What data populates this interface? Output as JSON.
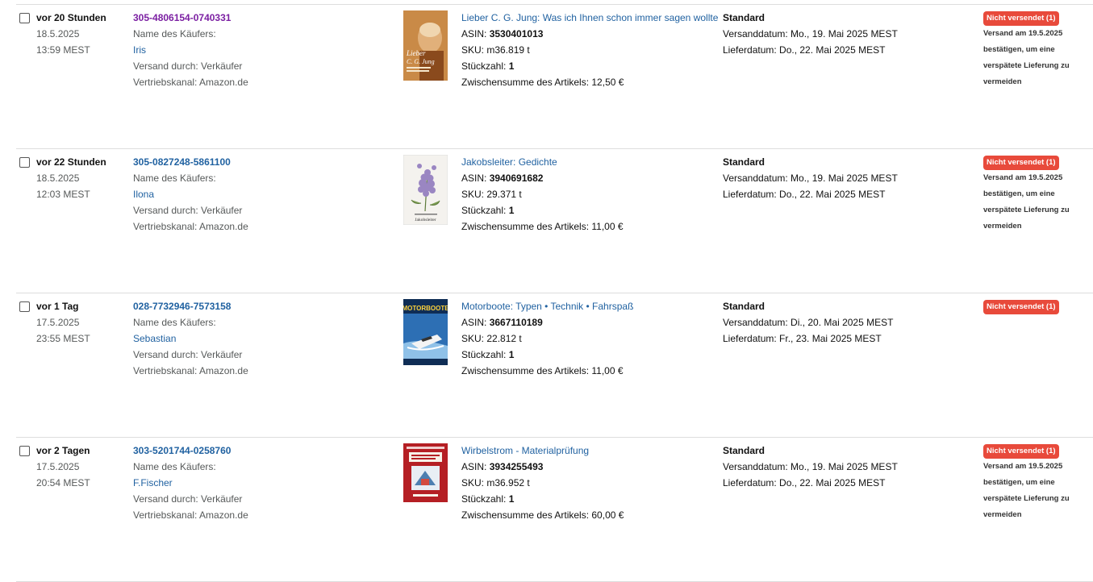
{
  "orders": [
    {
      "age": "vor 20 Stunden",
      "date": "18.5.2025",
      "time": "13:59 MEST",
      "order_id": "305-4806154-0740331",
      "buyer_label": "Name des Käufers:",
      "buyer_name": "Iris",
      "fulfilled_by": "Versand durch: Verkäufer",
      "sales_channel": "Vertriebskanal: Amazon.de",
      "product_title": "Lieber C. G. Jung: Was ich Ihnen schon immer sagen wollte",
      "asin_label": "ASIN:",
      "asin": "3530401013",
      "sku": "SKU: m36.819 t",
      "qty_label": "Stückzahl:",
      "qty": "1",
      "subtotal": "Zwischensumme des Artikels: 12,50 €",
      "shipping_service": "Standard",
      "ship_date": "Versanddatum: Mo., 19. Mai 2025 MEST",
      "delivery_date": "Lieferdatum: Do., 22. Mai 2025 MEST",
      "status_badge": "Nicht versendet (1)",
      "status_note": [
        "Versand am 19.5.2025",
        "bestätigen, um eine",
        "verspätete Lieferung zu",
        "vermeiden"
      ],
      "cover_icon": "book-cover-lieber-cg-jung",
      "cover_text": [
        "Lieber",
        "C. G. Jung"
      ]
    },
    {
      "age": "vor 22 Stunden",
      "date": "18.5.2025",
      "time": "12:03 MEST",
      "order_id": "305-0827248-5861100",
      "buyer_label": "Name des Käufers:",
      "buyer_name": "Ilona",
      "fulfilled_by": "Versand durch: Verkäufer",
      "sales_channel": "Vertriebskanal: Amazon.de",
      "product_title": "Jakobsleiter: Gedichte",
      "asin_label": "ASIN:",
      "asin": "3940691682",
      "sku": "SKU: 29.371 t",
      "qty_label": "Stückzahl:",
      "qty": "1",
      "subtotal": "Zwischensumme des Artikels: 11,00 €",
      "shipping_service": "Standard",
      "ship_date": "Versanddatum: Mo., 19. Mai 2025 MEST",
      "delivery_date": "Lieferdatum: Do., 22. Mai 2025 MEST",
      "status_badge": "Nicht versendet (1)",
      "status_note": [
        "Versand am 19.5.2025",
        "bestätigen, um eine",
        "verspätete Lieferung zu",
        "vermeiden"
      ],
      "cover_icon": "book-cover-jakobsleiter",
      "cover_text": [
        "Jakobsleiter"
      ]
    },
    {
      "age": "vor 1 Tag",
      "date": "17.5.2025",
      "time": "23:55 MEST",
      "order_id": "028-7732946-7573158",
      "buyer_label": "Name des Käufers:",
      "buyer_name": "Sebastian",
      "fulfilled_by": "Versand durch: Verkäufer",
      "sales_channel": "Vertriebskanal: Amazon.de",
      "product_title": "Motorboote: Typen • Technik • Fahrspaß",
      "asin_label": "ASIN:",
      "asin": "3667110189",
      "sku": "SKU: 22.812 t",
      "qty_label": "Stückzahl:",
      "qty": "1",
      "subtotal": "Zwischensumme des Artikels: 11,00 €",
      "shipping_service": "Standard",
      "ship_date": "Versanddatum: Di., 20. Mai 2025 MEST",
      "delivery_date": "Lieferdatum: Fr., 23. Mai 2025 MEST",
      "status_badge": "Nicht versendet (1)",
      "status_note": [],
      "cover_icon": "book-cover-motorboote",
      "cover_text": [
        "MOTORBOOTE"
      ]
    },
    {
      "age": "vor 2 Tagen",
      "date": "17.5.2025",
      "time": "20:54 MEST",
      "order_id": "303-5201744-0258760",
      "buyer_label": "Name des Käufers:",
      "buyer_name": "F.Fischer",
      "fulfilled_by": "Versand durch: Verkäufer",
      "sales_channel": "Vertriebskanal: Amazon.de",
      "product_title": "Wirbelstrom - Materialprüfung",
      "asin_label": "ASIN:",
      "asin": "3934255493",
      "sku": "SKU: m36.952 t",
      "qty_label": "Stückzahl:",
      "qty": "1",
      "subtotal": "Zwischensumme des Artikels: 60,00 €",
      "shipping_service": "Standard",
      "ship_date": "Versanddatum: Mo., 19. Mai 2025 MEST",
      "delivery_date": "Lieferdatum: Do., 22. Mai 2025 MEST",
      "status_badge": "Nicht versendet (1)",
      "status_note": [
        "Versand am 19.5.2025",
        "bestätigen, um eine",
        "verspätete Lieferung zu",
        "vermeiden"
      ],
      "cover_icon": "book-cover-wirbelstrom",
      "cover_text": []
    }
  ],
  "colors": {
    "link": "#2162a1",
    "visited_link": "#7b1fa2",
    "badge": "#e84a3b",
    "muted_text": "#565959",
    "divider": "#dddddd"
  }
}
